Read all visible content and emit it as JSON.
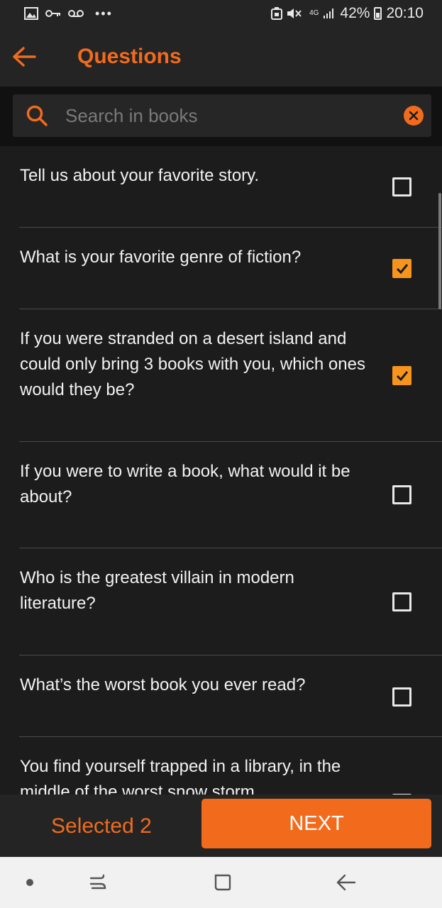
{
  "status_bar": {
    "left_icons": [
      "image-icon",
      "key-icon",
      "voicemail-icon",
      "more-dots-icon"
    ],
    "network": "4G",
    "battery": "42%",
    "time": "20:10"
  },
  "header": {
    "title": "Questions",
    "back_icon": "arrow-left-icon",
    "accent_color": "#f26b1d"
  },
  "search": {
    "placeholder": "Search in books",
    "value": "",
    "icon": "search-icon",
    "clear_icon": "clear-icon"
  },
  "questions": [
    {
      "text": "Tell us about your favorite story.",
      "checked": false
    },
    {
      "text": "What is your favorite genre of fiction?",
      "checked": true
    },
    {
      "text": "If you were stranded on a desert island and could only bring 3 books with you, which ones would they be?",
      "checked": true
    },
    {
      "text": "If you were to write a book, what would it be about?",
      "checked": false
    },
    {
      "text": "Who is the greatest villain in modern literature?",
      "checked": false
    },
    {
      "text": "What’s the worst book you ever read?",
      "checked": false
    },
    {
      "text": "You find yourself trapped in a library, in the middle of the worst snow storm",
      "checked": false
    }
  ],
  "footer": {
    "selected_label": "Selected 2",
    "next_label": "NEXT"
  },
  "nav_bar": {
    "buttons": [
      "recent-apps-icon",
      "home-icon",
      "back-icon"
    ]
  }
}
